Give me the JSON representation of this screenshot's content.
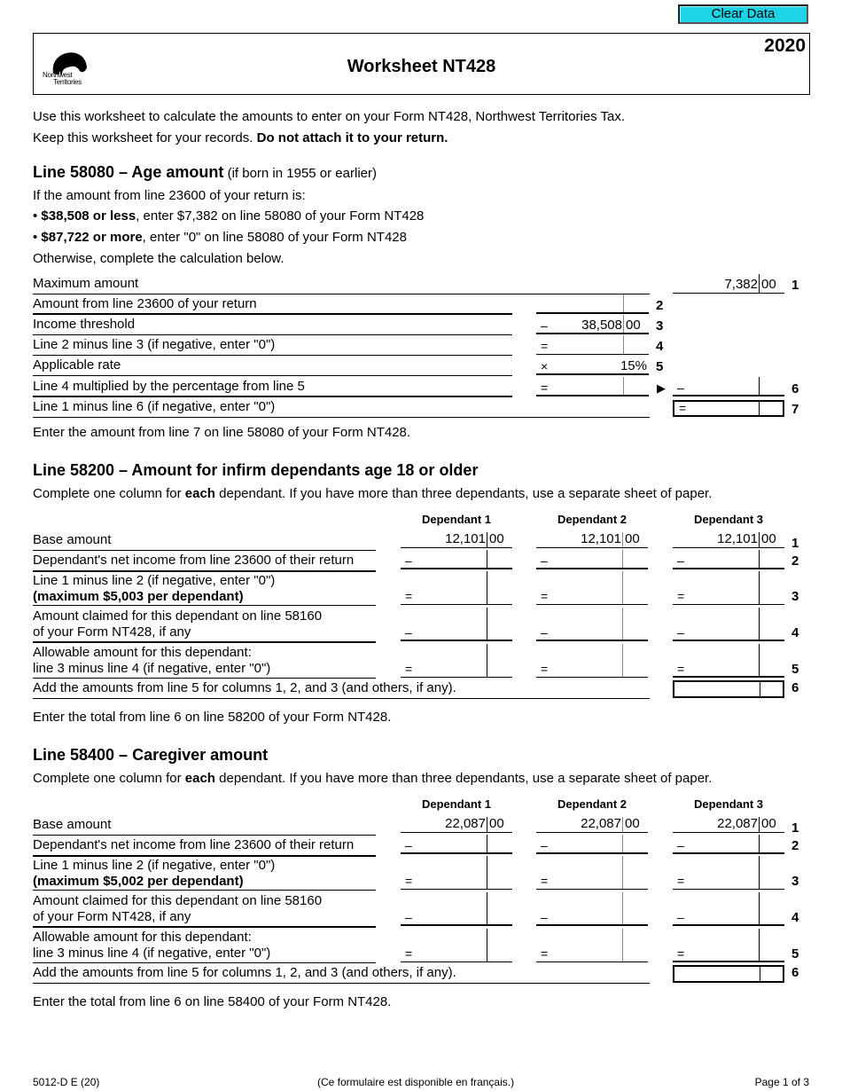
{
  "toolbar": {
    "clear_data_label": "Clear Data"
  },
  "header": {
    "year": "2020",
    "title": "Worksheet NT428",
    "logo_line1": "Northwest",
    "logo_line2": "Territories"
  },
  "intro": {
    "line1": "Use this worksheet to calculate the amounts to enter on your Form NT428, Northwest Territories Tax.",
    "line2_normal": "Keep this worksheet for your records. ",
    "line2_bold": "Do not attach it to your return."
  },
  "section_age": {
    "title": "Line 58080 – Age amount",
    "subtitle": " (if born in 1955 or earlier)",
    "condition_intro": "If the amount from line 23600 of your return is:",
    "bullet1_bold": "$38,508 or less",
    "bullet1_rest": ", enter $7,382 on line 58080 of your Form NT428",
    "bullet2_bold": "$87,722 or more",
    "bullet2_rest": ", enter \"0\" on line 58080 of your Form NT428",
    "otherwise": "Otherwise, complete the calculation below.",
    "rows": [
      {
        "num": "1",
        "label": "Maximum amount",
        "dollars": "7,382",
        "cents": "00"
      },
      {
        "num": "2",
        "label": "Amount from line 23600 of your return",
        "dollars": "",
        "cents": ""
      },
      {
        "num": "3",
        "label": "Income threshold",
        "op": "–",
        "dollars": "38,508",
        "cents": "00"
      },
      {
        "num": "4",
        "label": "Line 2 minus line 3 (if negative, enter \"0\")",
        "op": "=",
        "dollars": "",
        "cents": ""
      },
      {
        "num": "5",
        "label": "Applicable rate",
        "op": "×",
        "value": "15%"
      },
      {
        "num": "6",
        "label": "Line 4 multiplied by the percentage from line 5",
        "op": "=",
        "op2": "–",
        "dollars": "",
        "cents": ""
      },
      {
        "num": "7",
        "label": "Line 1 minus line 6 (if negative, enter \"0\")",
        "op": "=",
        "dollars": "",
        "cents": ""
      }
    ],
    "note": "Enter the amount from line 7 on line 58080 of your Form NT428."
  },
  "section_infirm": {
    "title": "Line 58200 – Amount for infirm dependants age 18 or older",
    "instr_pre": "Complete one column for ",
    "instr_bold": "each",
    "instr_post": " dependant. If you have more than three dependants, use a separate sheet of paper.",
    "columns": [
      "Dependant 1",
      "Dependant 2",
      "Dependant 3"
    ],
    "base_dollars": "12,101",
    "base_cents": "00",
    "rows": [
      {
        "num": "1",
        "label": "Base amount"
      },
      {
        "num": "2",
        "label": "Dependant's net income from line 23600 of their return",
        "op": "–"
      },
      {
        "num": "3",
        "label": "Line 1 minus line 2 (if negative, enter \"0\")",
        "label_bold": "(maximum $5,003 per dependant)",
        "op": "="
      },
      {
        "num": "4",
        "label": "Amount claimed for this dependant on line 58160",
        "label2": "of your Form NT428, if any",
        "op": "–"
      },
      {
        "num": "5",
        "label": "Allowable amount for this dependant:",
        "label2": "line 3 minus line 4 (if negative, enter \"0\")",
        "op": "="
      },
      {
        "num": "6",
        "label": "Add the amounts from line 5 for columns 1, 2, and 3 (and others, if any)."
      }
    ],
    "note": "Enter the total from line 6 on line 58200 of your Form NT428."
  },
  "section_caregiver": {
    "title": "Line 58400 – Caregiver amount",
    "instr_pre": "Complete one column for ",
    "instr_bold": "each",
    "instr_post": " dependant. If you have more than three dependants, use a separate sheet of paper.",
    "columns": [
      "Dependant 1",
      "Dependant 2",
      "Dependant 3"
    ],
    "base_dollars": "22,087",
    "base_cents": "00",
    "rows": [
      {
        "num": "1",
        "label": "Base amount"
      },
      {
        "num": "2",
        "label": "Dependant's net income from line 23600 of their return",
        "op": "–"
      },
      {
        "num": "3",
        "label": "Line 1 minus line 2 (if negative, enter \"0\")",
        "label_bold": "(maximum $5,002 per dependant)",
        "op": "="
      },
      {
        "num": "4",
        "label": "Amount claimed for this dependant on line 58160",
        "label2": "of your Form NT428, if any",
        "op": "–"
      },
      {
        "num": "5",
        "label": "Allowable amount for this dependant:",
        "label2": "line 3 minus line 4 (if negative, enter \"0\")",
        "op": "="
      },
      {
        "num": "6",
        "label": "Add the amounts from line 5 for columns 1, 2, and 3 (and others, if any)."
      }
    ],
    "note": "Enter the total from line 6 on line 58400 of your Form NT428."
  },
  "footer": {
    "form_code": "5012-D E (20)",
    "french_note": "(Ce formulaire est disponible en français.)",
    "page": "Page 1 of 3"
  }
}
